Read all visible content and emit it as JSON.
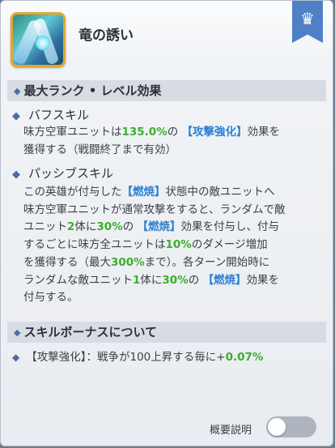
{
  "header": {
    "skill_name": "竜の誘い",
    "icon": "dragon-lure-skill-icon",
    "badge_icon": "crown-icon"
  },
  "section_max_rank": {
    "title": "最大ランク • レベル効果",
    "buff": {
      "title": "バフスキル",
      "line1_a": "味方空軍ユニットは",
      "line1_value": "135.0%",
      "line1_b": "の",
      "line1_tag": "【攻撃強化】",
      "line1_c": "効果を",
      "line2": "獲得する（戦闘終了まで有効）"
    },
    "passive": {
      "title": "パッシブスキル",
      "l1_a": "この英雄が付与した",
      "l1_tag": "【燃焼】",
      "l1_b": "状態中の敵ユニットへ",
      "l2": "味方空軍ユニットが通常攻撃をすると、ランダムで敵",
      "l3_a": "ユニット",
      "l3_n1": "2",
      "l3_b": "体に",
      "l3_pct": "30%",
      "l3_c": "の",
      "l3_tag": "【燃焼】",
      "l3_d": "効果を付与し、付与",
      "l4_a": "するごとに味方全ユニットは",
      "l4_pct": "10%",
      "l4_b": "のダメージ増加",
      "l5_a": "を獲得する（最大",
      "l5_pct": "300%",
      "l5_b": "まで）。各ターン開始時に",
      "l6_a": "ランダムな敵ユニット",
      "l6_n": "1",
      "l6_b": "体に",
      "l6_pct": "30%",
      "l6_c": "の",
      "l6_tag": "【燃焼】",
      "l6_d": "効果を",
      "l7": "付与する。"
    }
  },
  "section_bonus": {
    "title": "スキルボーナスについて",
    "line_a": "【攻撃強化】：戦争が100上昇する毎に+",
    "line_value": "0.07%"
  },
  "footer": {
    "toggle_label": "概要説明",
    "toggle_on": false
  },
  "colors": {
    "accent_blue": "#2d7fd3",
    "value_green": "#3bae2c",
    "badge": "#4f7fc6",
    "icon_border": "#e3a72e"
  }
}
